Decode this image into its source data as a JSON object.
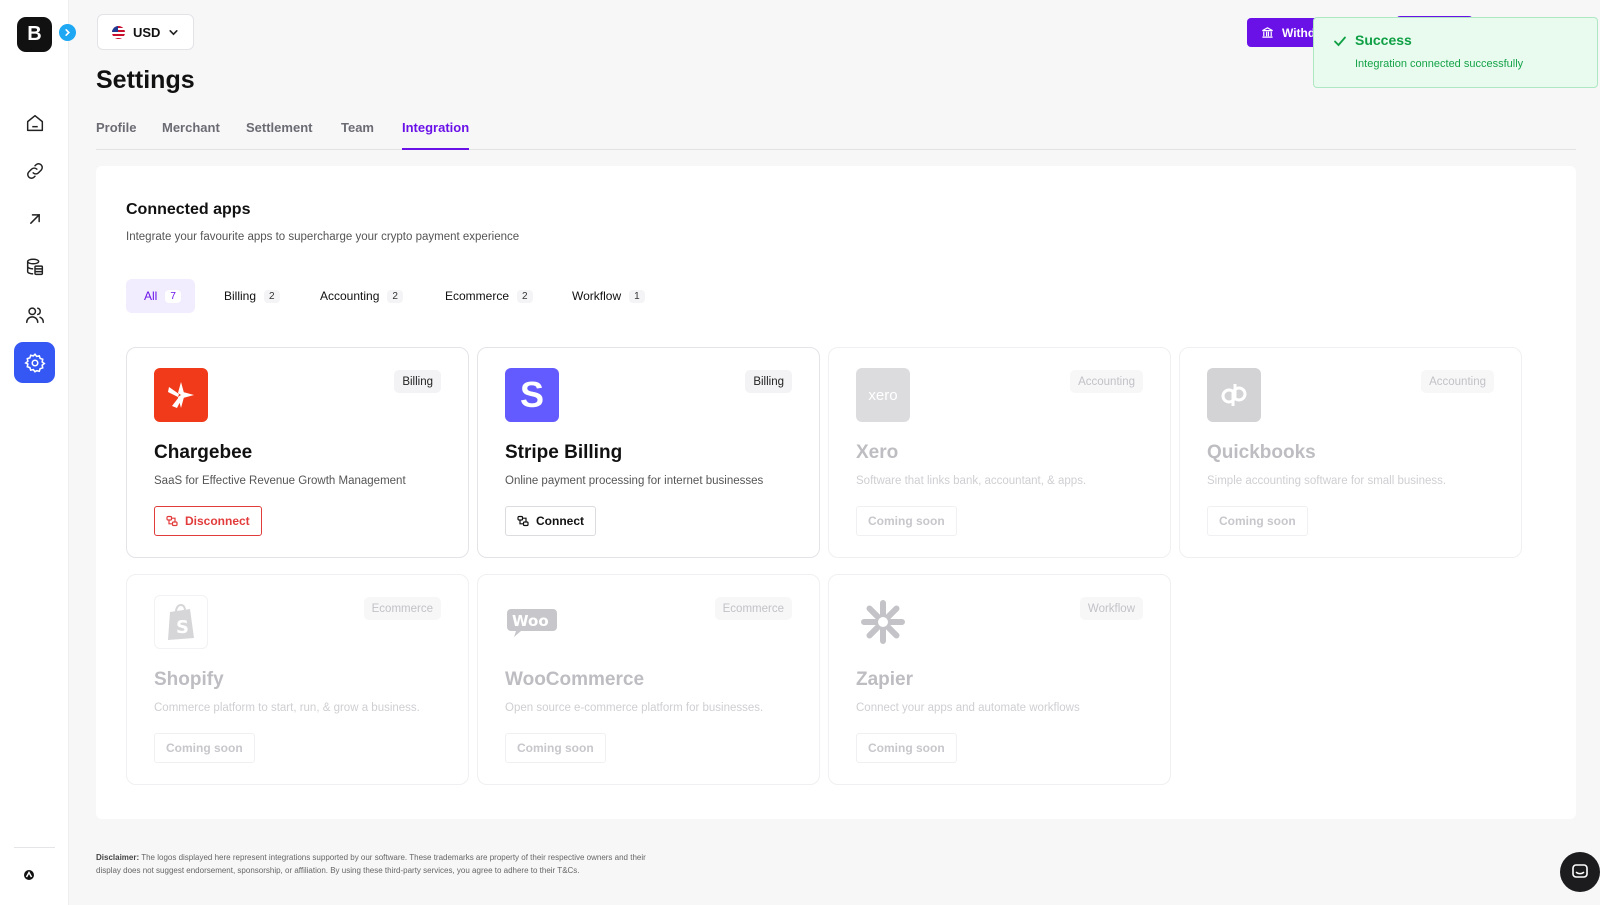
{
  "sidebar": {
    "logo_letter": "B",
    "items": [
      {
        "name": "home",
        "icon": "home-icon"
      },
      {
        "name": "links",
        "icon": "link-icon"
      },
      {
        "name": "payouts",
        "icon": "arrow-up-right-icon"
      },
      {
        "name": "transactions",
        "icon": "database-icon"
      },
      {
        "name": "customers",
        "icon": "users-icon"
      },
      {
        "name": "settings",
        "icon": "gear-icon",
        "active": true
      }
    ]
  },
  "topbar": {
    "currency": "USD",
    "withdraw_label": "Withdr",
    "accent_color": "#6a11e8"
  },
  "toast": {
    "title": "Success",
    "message": "Integration connected successfully"
  },
  "page": {
    "title": "Settings",
    "tabs": [
      "Profile",
      "Merchant",
      "Settlement",
      "Team",
      "Integration"
    ],
    "active_tab": "Integration"
  },
  "section": {
    "title": "Connected apps",
    "subtitle": "Integrate your favourite apps to supercharge your crypto payment experience"
  },
  "filters": [
    {
      "label": "All",
      "count": "7",
      "active": true
    },
    {
      "label": "Billing",
      "count": "2"
    },
    {
      "label": "Accounting",
      "count": "2"
    },
    {
      "label": "Ecommerce",
      "count": "2"
    },
    {
      "label": "Workflow",
      "count": "1"
    }
  ],
  "apps": [
    {
      "name": "Chargebee",
      "category": "Billing",
      "description": "SaaS for Effective Revenue Growth Management",
      "action": "Disconnect",
      "logo_color": "#f03a1a"
    },
    {
      "name": "Stripe Billing",
      "category": "Billing",
      "description": "Online payment processing for internet businesses",
      "action": "Connect",
      "logo_color": "#635bff"
    },
    {
      "name": "Xero",
      "category": "Accounting",
      "description": "Software that links bank, accountant, & apps.",
      "action": "Coming soon"
    },
    {
      "name": "Quickbooks",
      "category": "Accounting",
      "description": "Simple accounting software for small business.",
      "action": "Coming soon"
    },
    {
      "name": "Shopify",
      "category": "Ecommerce",
      "description": "Commerce platform to start, run, & grow a business.",
      "action": "Coming soon"
    },
    {
      "name": "WooCommerce",
      "category": "Ecommerce",
      "description": "Open source e-commerce platform for businesses.",
      "action": "Coming soon"
    },
    {
      "name": "Zapier",
      "category": "Workflow",
      "description": "Connect your apps and automate workflows",
      "action": "Coming soon"
    }
  ],
  "disclaimer": {
    "label": "Disclaimer:",
    "text": "The logos displayed here represent integrations supported by our software. These trademarks are property of their respective owners and their display does not suggest endorsement, sponsorship, or affiliation. By using these third-party services, you agree to adhere to their T&Cs."
  }
}
